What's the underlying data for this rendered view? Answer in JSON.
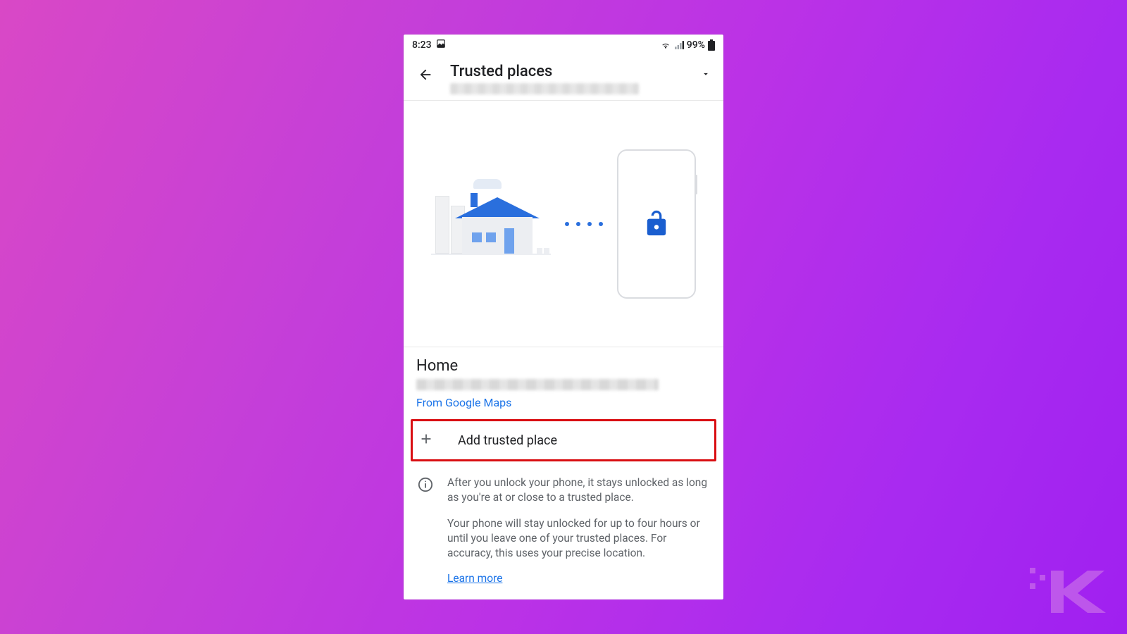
{
  "status": {
    "time": "8:23",
    "battery_pct": "99%"
  },
  "appbar": {
    "title": "Trusted places"
  },
  "place": {
    "name": "Home",
    "source": "From Google Maps"
  },
  "add_row": {
    "label": "Add trusted place"
  },
  "info": {
    "p1": "After you unlock your phone, it stays unlocked as long as you're at or close to a trusted place.",
    "p2": "Your phone will stay unlocked for up to four hours or until you leave one of your trusted places. For accuracy, this uses your precise location.",
    "learn": "Learn more"
  }
}
